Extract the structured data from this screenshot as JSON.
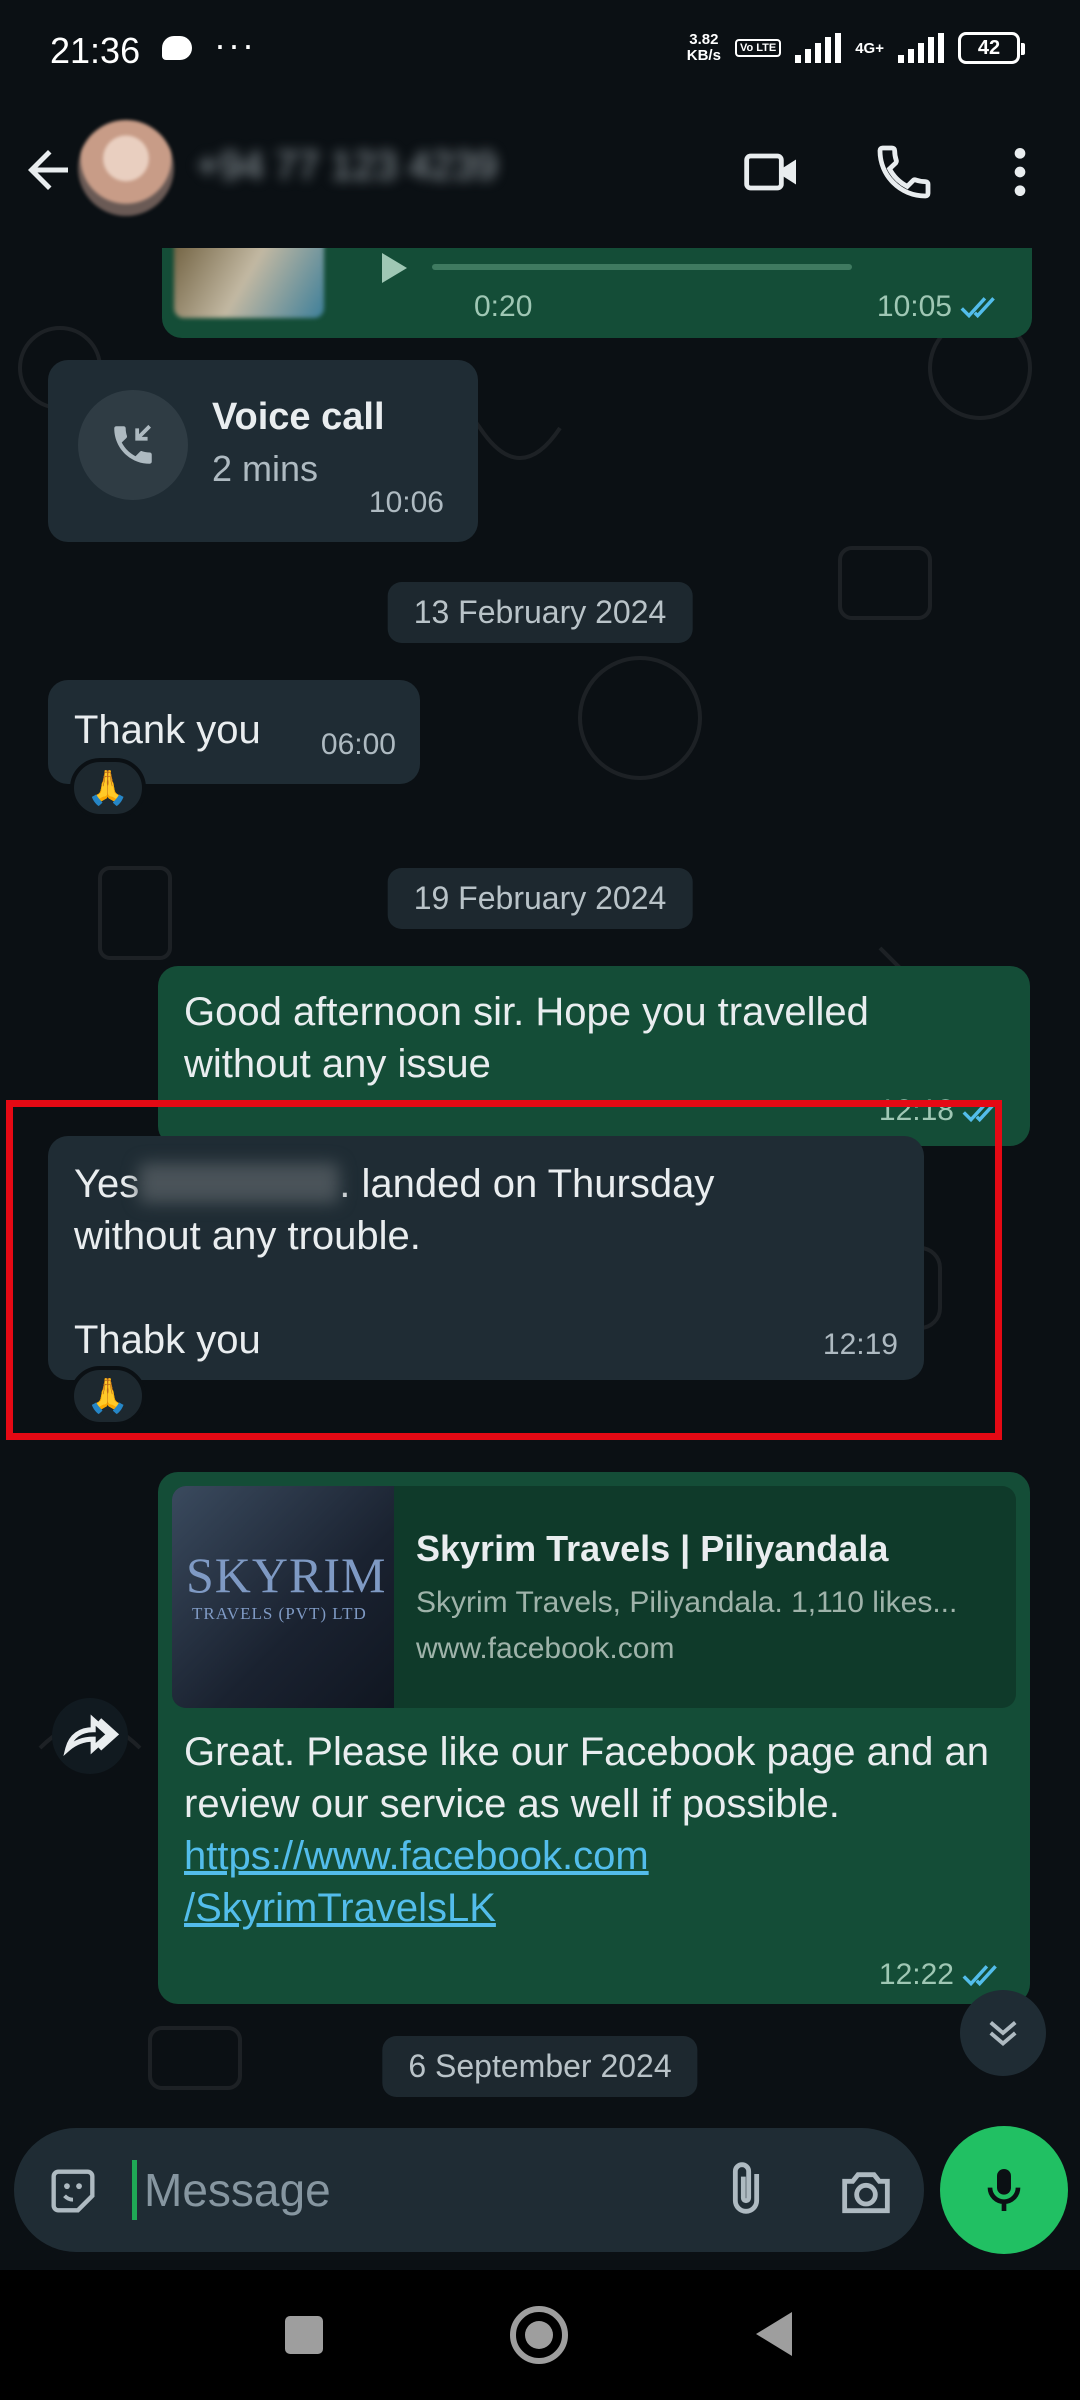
{
  "status_bar": {
    "time": "21:36",
    "speed_value": "3.82",
    "speed_unit": "KB/s",
    "volte": "Vo LTE",
    "network": "4G+",
    "battery": "42"
  },
  "header": {
    "contact_name": "+94 77 123 4239"
  },
  "messages": {
    "voice_note": {
      "duration": "0:20",
      "time": "10:05"
    },
    "voice_call": {
      "title": "Voice call",
      "duration": "2 mins",
      "time": "10:06"
    },
    "date1": "13 February 2024",
    "thank_you": {
      "text": "Thank you",
      "time": "06:00",
      "reaction": "🙏"
    },
    "date2": "19 February 2024",
    "good_afternoon": {
      "text": "Good afternoon sir. Hope you travelled without any issue",
      "time": "12:18"
    },
    "yes_reply": {
      "prefix": "Yes",
      "line1_rest": ". landed on Thursday",
      "line2": "without any trouble.",
      "line3": "Thabk you",
      "time": "12:19",
      "reaction": "🙏"
    },
    "link_message": {
      "thumb_brand": "SKYRIM",
      "thumb_sub": "TRAVELS (PVT) LTD",
      "preview_title": "Skyrim Travels | Piliyandala",
      "preview_desc": "Skyrim Travels, Piliyandala. 1,110 likes...",
      "preview_domain": "www.facebook.com",
      "text": "Great. Please like our Facebook page and an review our service as well if possible.",
      "url_line1": "https://www.facebook.com",
      "url_line2": "/SkyrimTravelsLK",
      "time": "12:22"
    },
    "date3": "6 September 2024"
  },
  "input": {
    "placeholder": "Message"
  },
  "colors": {
    "accent": "#21c063",
    "outgoing_bubble": "#144d37",
    "incoming_bubble": "#1f2c34",
    "highlight": "#e50914",
    "read_ticks": "#53bdeb"
  }
}
